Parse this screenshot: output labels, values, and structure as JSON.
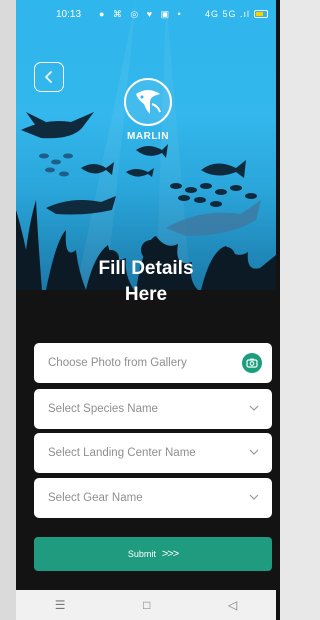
{
  "status_bar": {
    "time": "10:13",
    "notification_icons": "● ⌘ ◎ ♥ ▣ •",
    "network_text": "4G 5G .ıl"
  },
  "header": {
    "back_icon": "chevron-left",
    "logo_text": "MARLIN"
  },
  "form": {
    "title_line1": "Fill Details",
    "title_line2": "Here",
    "photo_placeholder": "Choose Photo from Gallery",
    "species_placeholder": "Select Species Name",
    "landing_placeholder": "Select Landing Center Name",
    "gear_placeholder": "Select Gear Name",
    "submit_label": "Submit",
    "submit_arrows": ">>>"
  },
  "nav": {
    "menu": "☰",
    "home": "□",
    "back": "◁"
  },
  "colors": {
    "sky_blue": "#2fb6ec",
    "dark_bg": "#131313",
    "accent_green": "#1f9c80",
    "field_bg": "#ffffff"
  }
}
